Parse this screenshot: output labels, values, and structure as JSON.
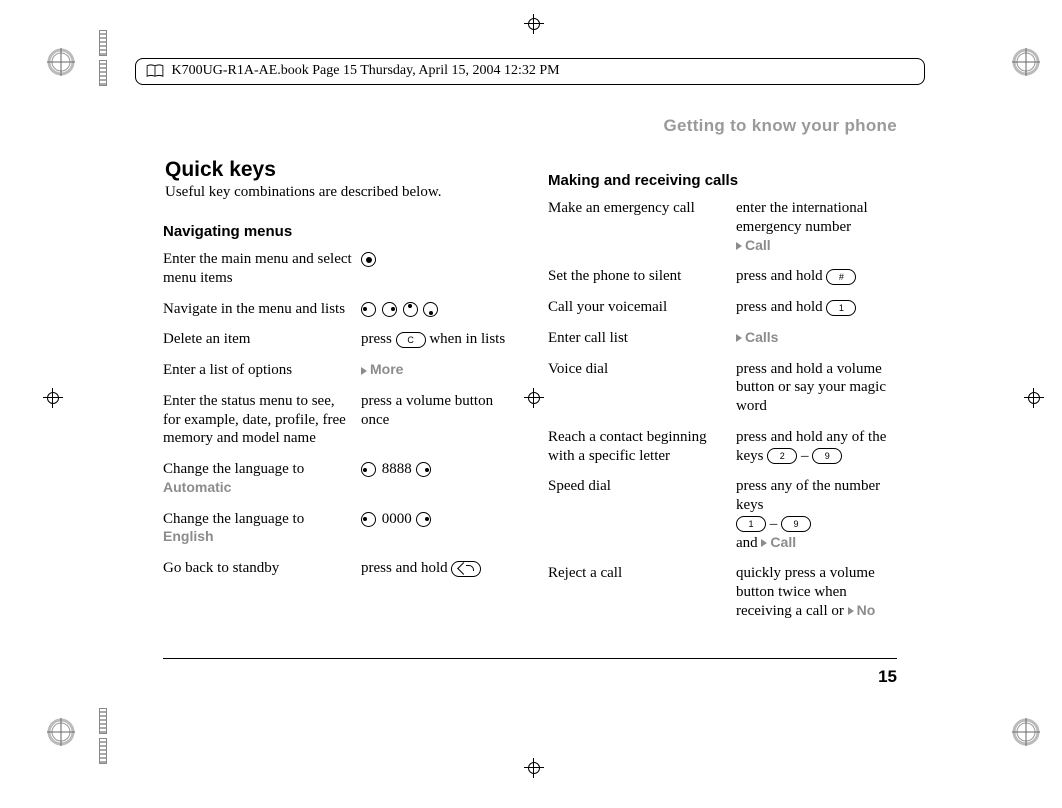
{
  "meta_line": "K700UG-R1A-AE.book  Page 15  Thursday, April 15, 2004  12:32 PM",
  "section_header": "Getting to know your phone",
  "title": "Quick keys",
  "intro": "Useful key combinations are described below.",
  "page_number": "15",
  "col_left": {
    "heading": "Navigating menus",
    "rows": {
      "r0": {
        "a": "Enter the main menu and select menu items"
      },
      "r1": {
        "a": "Navigate in the menu and lists"
      },
      "r2": {
        "a": "Delete an item",
        "b_pre": "press ",
        "b_post": " when in lists",
        "key": "C"
      },
      "r3": {
        "a": "Enter a list of options",
        "b_label": "More"
      },
      "r4": {
        "a": "Enter the status menu to see, for example, date, profile, free memory and model name",
        "b": "press a volume button once"
      },
      "r5": {
        "a_pre": "Change the language to ",
        "a_label": "Automatic",
        "code": "8888"
      },
      "r6": {
        "a_pre": "Change the language to ",
        "a_label": "English",
        "code": "0000"
      },
      "r7": {
        "a": "Go back to standby",
        "b_pre": "press and hold "
      }
    }
  },
  "col_right": {
    "heading": "Making and receiving calls",
    "rows": {
      "r0": {
        "a": "Make an emergency call",
        "b": "enter the international emergency number",
        "b_label": "Call"
      },
      "r1": {
        "a": "Set the phone to silent",
        "b_pre": "press and hold ",
        "key": "#"
      },
      "r2": {
        "a": "Call your voicemail",
        "b_pre": "press and hold ",
        "key": "1"
      },
      "r3": {
        "a": "Enter call list",
        "b_label": "Calls"
      },
      "r4": {
        "a": "Voice dial",
        "b": "press and hold a volume button or say your magic word"
      },
      "r5": {
        "a": "Reach a contact beginning with a specific letter",
        "b_pre": "press and hold any of the keys ",
        "k1": "2",
        "sep": " – ",
        "k2": "9"
      },
      "r6": {
        "a": "Speed dial",
        "b_pre": "press any of the number keys",
        "k1": "1",
        "sep": " – ",
        "k2": "9",
        "b_post_pre": "and ",
        "b_label": "Call"
      },
      "r7": {
        "a": "Reject a call",
        "b": "quickly press a volume button twice when receiving a call or ",
        "b_label": "No"
      }
    }
  }
}
